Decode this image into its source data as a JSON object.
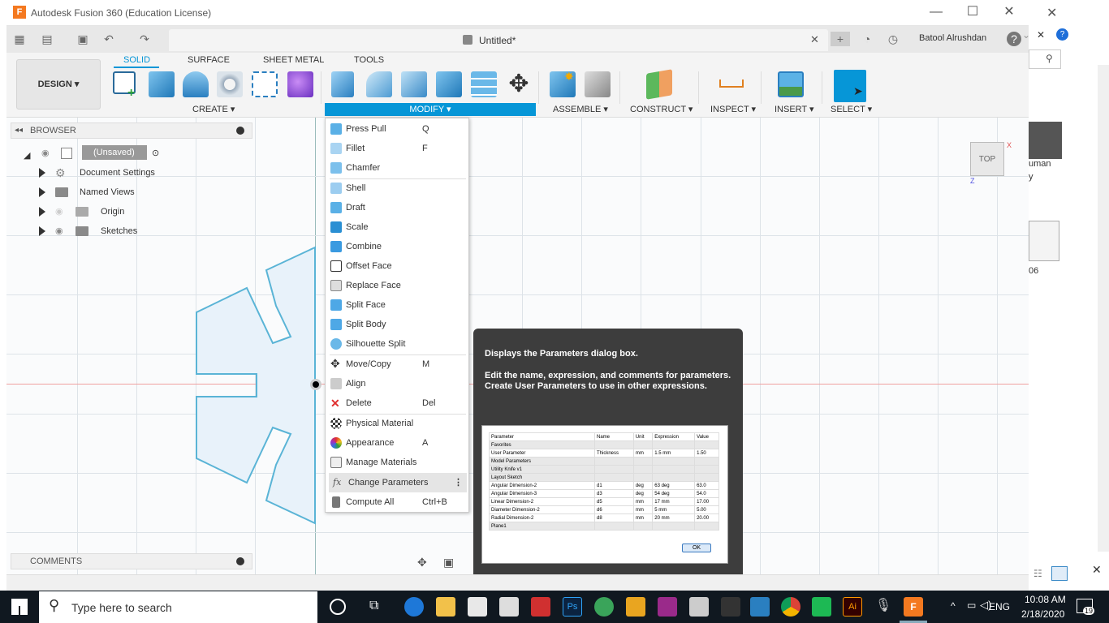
{
  "window": {
    "title": "Autodesk Fusion 360 (Education License)",
    "document_name": "Untitled*",
    "user": "Batool Alrushdan"
  },
  "workspace": {
    "label": "DESIGN",
    "tabs": [
      "SOLID",
      "SURFACE",
      "SHEET METAL",
      "TOOLS"
    ],
    "active_tab": "SOLID",
    "groups": [
      "CREATE",
      "MODIFY",
      "ASSEMBLE",
      "CONSTRUCT",
      "INSPECT",
      "INSERT",
      "SELECT"
    ]
  },
  "browser": {
    "header": "BROWSER",
    "items": [
      {
        "label": "(Unsaved)"
      },
      {
        "label": "Document Settings"
      },
      {
        "label": "Named Views"
      },
      {
        "label": "Origin"
      },
      {
        "label": "Sketches"
      }
    ]
  },
  "modify_menu": {
    "items": [
      {
        "label": "Press Pull",
        "shortcut": "Q"
      },
      {
        "label": "Fillet",
        "shortcut": "F"
      },
      {
        "label": "Chamfer",
        "shortcut": ""
      },
      {
        "label": "Shell",
        "shortcut": ""
      },
      {
        "label": "Draft",
        "shortcut": ""
      },
      {
        "label": "Scale",
        "shortcut": ""
      },
      {
        "label": "Combine",
        "shortcut": ""
      },
      {
        "label": "Offset Face",
        "shortcut": ""
      },
      {
        "label": "Replace Face",
        "shortcut": ""
      },
      {
        "label": "Split Face",
        "shortcut": ""
      },
      {
        "label": "Split Body",
        "shortcut": ""
      },
      {
        "label": "Silhouette Split",
        "shortcut": ""
      },
      {
        "label": "Move/Copy",
        "shortcut": "M"
      },
      {
        "label": "Align",
        "shortcut": ""
      },
      {
        "label": "Delete",
        "shortcut": "Del"
      },
      {
        "label": "Physical Material",
        "shortcut": ""
      },
      {
        "label": "Appearance",
        "shortcut": "A"
      },
      {
        "label": "Manage Materials",
        "shortcut": ""
      },
      {
        "label": "Change Parameters",
        "shortcut": ""
      },
      {
        "label": "Compute All",
        "shortcut": "Ctrl+B"
      }
    ]
  },
  "tooltip": {
    "title": "Displays the Parameters dialog box.",
    "body": "Edit the name, expression, and comments for parameters. Create User Parameters to use in other expressions.",
    "table_headers": [
      "Parameter",
      "Name",
      "Unit",
      "Expression",
      "Value"
    ],
    "table_rows": [
      [
        "Favorites",
        "",
        "",
        "",
        ""
      ],
      [
        "User Parameter",
        "Thickness",
        "mm",
        "1.5 mm",
        "1.50"
      ],
      [
        "Model Parameters",
        "",
        "",
        "",
        ""
      ],
      [
        "Utility Knife v1",
        "",
        "",
        "",
        ""
      ],
      [
        "Layout Sketch",
        "",
        "",
        "",
        ""
      ],
      [
        "Angular Dimension-2",
        "d1",
        "deg",
        "63 deg",
        "63.0"
      ],
      [
        "Angular Dimension-3",
        "d3",
        "deg",
        "54 deg",
        "54.0"
      ],
      [
        "Linear Dimension-2",
        "d5",
        "mm",
        "17 mm",
        "17.00"
      ],
      [
        "Diameter Dimension-2",
        "d6",
        "mm",
        "5 mm",
        "5.00"
      ],
      [
        "Radial Dimension-2",
        "d8",
        "mm",
        "20 mm",
        "20.00"
      ],
      [
        "Plane1",
        "",
        "",
        "",
        ""
      ]
    ],
    "ok": "OK"
  },
  "viewcube": {
    "label": "TOP",
    "axis_x": "X",
    "axis_z": "Z"
  },
  "comments": {
    "label": "COMMENTS"
  },
  "taskbar": {
    "search_placeholder": "Type here to search",
    "time": "10:08 AM",
    "date": "2/18/2020",
    "language": "ENG",
    "notifications": "19"
  },
  "background_window": {
    "text_1": "uman",
    "text_2": "y",
    "text_3": "06"
  },
  "colors": {
    "accent": "#0696d7",
    "taskbar": "#101820",
    "tooltip": "#3d3d3d",
    "sketch_stroke": "#5ab4d6",
    "sketch_fill": "#e8f2fa"
  }
}
